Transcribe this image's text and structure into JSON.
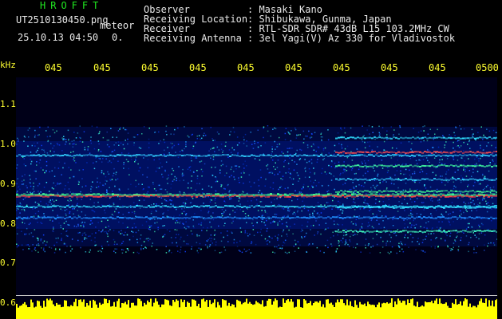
{
  "header": {
    "brand": "HROFFT",
    "filename": "UT2510130450.png",
    "mode": "meteor",
    "datetime": "25.10.13 04:50",
    "count": "0."
  },
  "info": [
    {
      "label": "Observer",
      "value": ": Masaki Kano"
    },
    {
      "label": "Receiving Location",
      "value": ": Shibukawa, Gunma, Japan"
    },
    {
      "label": "Receiver",
      "value": ": RTL-SDR SDR# 43dB L15 103.2MHz CW"
    },
    {
      "label": "Receiving Antenna",
      "value": ": 3el Yagi(V) Az 330 for Vladivostok"
    }
  ],
  "axis": {
    "unit": "kHz",
    "y_labels": [
      "1.1",
      "1.0",
      "0.9",
      "0.8",
      "0.7",
      "0.6"
    ],
    "x_labels": [
      "045",
      "045",
      "045",
      "045",
      "045",
      "045",
      "045",
      "045",
      "045",
      "0500"
    ]
  },
  "colors": {
    "background": "#000000",
    "spectrogram_bg": "#000018",
    "tick_text": "#ffff30",
    "brand": "#20e820",
    "signal_peak": "#ff3030",
    "noise_bar": "#ffff00"
  }
}
